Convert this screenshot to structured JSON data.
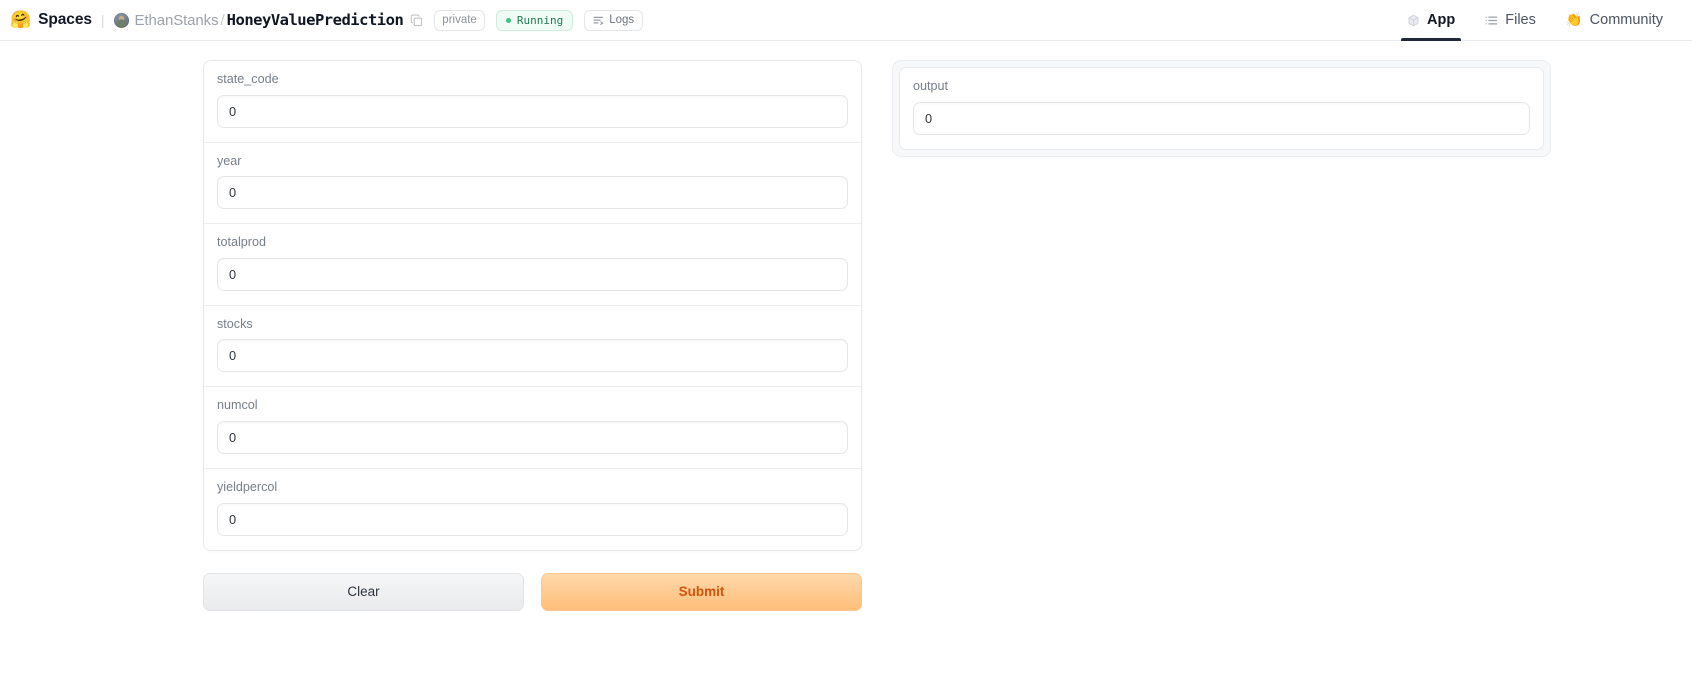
{
  "header": {
    "logo_icon": "hugging-face-emoji",
    "product": "Spaces",
    "owner": "EthanStanks",
    "separator": "/",
    "repo": "HoneyValuePrediction",
    "copy_icon": "copy-icon",
    "badges": {
      "visibility": "private",
      "status": "Running",
      "logs": "Logs"
    },
    "tabs": [
      {
        "label": "App",
        "icon": "cube-icon",
        "active": true
      },
      {
        "label": "Files",
        "icon": "file-list-icon",
        "active": false
      },
      {
        "label": "Community",
        "icon": "clapping-hands-emoji",
        "active": false
      }
    ],
    "colors": {
      "status_text": "#1f7a54",
      "status_bg": "#effbf4",
      "status_dot": "#3fbf84",
      "active_underline": "#1f2937"
    }
  },
  "app": {
    "inputs": [
      {
        "label": "state_code",
        "value": "0",
        "placeholder": "0"
      },
      {
        "label": "year",
        "value": "0",
        "placeholder": "0"
      },
      {
        "label": "totalprod",
        "value": "0",
        "placeholder": "0"
      },
      {
        "label": "stocks",
        "value": "0",
        "placeholder": "0"
      },
      {
        "label": "numcol",
        "value": "0",
        "placeholder": "0"
      },
      {
        "label": "yieldpercol",
        "value": "0",
        "placeholder": "0"
      }
    ],
    "buttons": {
      "clear": "Clear",
      "submit": "Submit"
    },
    "output": {
      "label": "output",
      "value": "0",
      "placeholder": "0"
    },
    "colors": {
      "submit_bg_top": "#ffd8ab",
      "submit_bg_bottom": "#ffbe79",
      "submit_text": "#d2540d",
      "clear_text": "#2c3440"
    }
  }
}
